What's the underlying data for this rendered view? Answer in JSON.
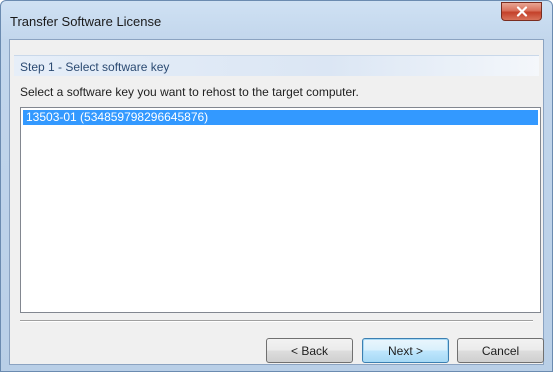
{
  "window": {
    "title": "Transfer Software License"
  },
  "step": {
    "title": "Step 1 - Select software key",
    "instruction": "Select a software key you want to rehost to the target computer."
  },
  "keys_list": {
    "items": [
      {
        "label": "13503-01 (534859798296645876)",
        "selected": true
      }
    ]
  },
  "buttons": {
    "back_label": "< Back",
    "next_label": "Next >",
    "cancel_label": "Cancel"
  },
  "icons": {
    "close": "close-icon"
  },
  "colors": {
    "selection": "#3399ff",
    "close_button": "#c4412a",
    "step_title_text": "#2b4a72"
  }
}
